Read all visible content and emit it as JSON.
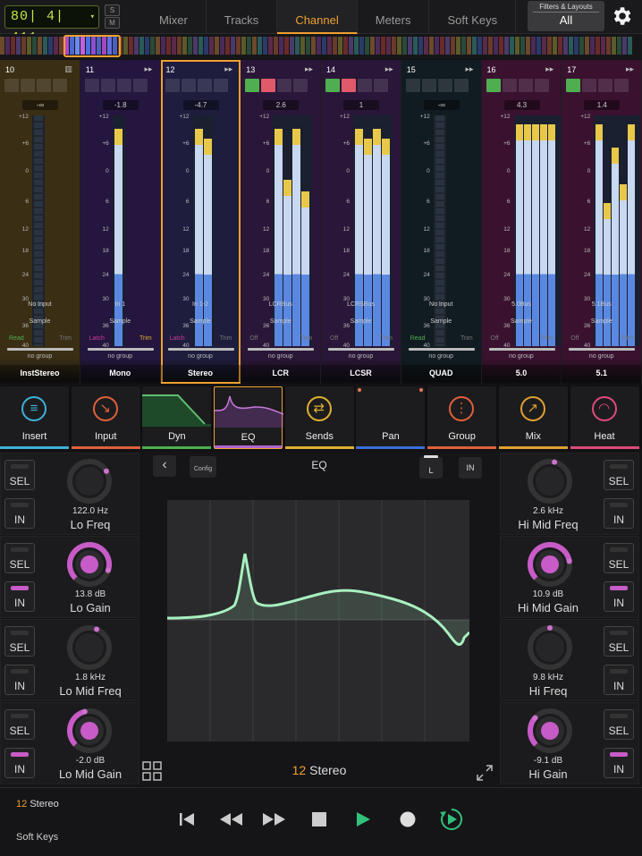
{
  "topbar": {
    "counter": "80| 4| 411",
    "tabs": [
      {
        "label": "Mixer"
      },
      {
        "label": "Tracks"
      },
      {
        "label": "Channel"
      },
      {
        "label": "Meters"
      },
      {
        "label": "Soft Keys"
      }
    ],
    "active_tab": "Channel",
    "filters_label": "Filters & Layouts",
    "filters_value": "All",
    "settings_icon": "gear-icon"
  },
  "channels": [
    {
      "num": "10",
      "gain": "-∞",
      "input": "No Input",
      "sample": "Sample",
      "auto": "Read",
      "trim": "Trim",
      "group": "no group",
      "name": "InstStereo",
      "color": "#3a2e14"
    },
    {
      "num": "11",
      "gain": "-1.8",
      "input": "In 1",
      "sample": "Sample",
      "auto": "Latch",
      "trim": "Trim",
      "group": "no group",
      "name": "Mono",
      "color": "#24163e"
    },
    {
      "num": "12",
      "gain": "-4.7",
      "input": "In 1-2",
      "sample": "Sample",
      "auto": "Latch",
      "trim": "Trim",
      "group": "no group",
      "name": "Stereo",
      "color": "#1e1d3e"
    },
    {
      "num": "13",
      "gain": "2.6",
      "input": "LCRBus",
      "sample": "Sample",
      "auto": "Off",
      "trim": "Trim",
      "group": "no group",
      "name": "LCR",
      "color": "#2a1638"
    },
    {
      "num": "14",
      "gain": "1",
      "input": "LCRSBus",
      "sample": "Sample",
      "auto": "Off",
      "trim": "Trim",
      "group": "no group",
      "name": "LCSR",
      "color": "#2a1638"
    },
    {
      "num": "15",
      "gain": "-∞",
      "input": "No Input",
      "sample": "Sample",
      "auto": "Read",
      "trim": "Trim",
      "group": "no group",
      "name": "QUAD",
      "color": "#111c22"
    },
    {
      "num": "16",
      "gain": "4.3",
      "input": "5.0Bus",
      "sample": "Sample",
      "auto": "Off",
      "trim": "Trim",
      "group": "no group",
      "name": "5.0",
      "color": "#3a1230"
    },
    {
      "num": "17",
      "gain": "1.4",
      "input": "5.1Bus",
      "sample": "Sample",
      "auto": "Off",
      "trim": "Trim",
      "group": "no group",
      "name": "5.1",
      "color": "#3a1230"
    }
  ],
  "scale_labels": [
    "+12",
    "+6",
    "0",
    "6",
    "12",
    "18",
    "24",
    "30",
    "36",
    "40"
  ],
  "sections": [
    {
      "label": "Insert",
      "color": "#3fb0d8"
    },
    {
      "label": "Input",
      "color": "#e0603a"
    },
    {
      "label": "Dyn",
      "color": "#4caf50"
    },
    {
      "label": "EQ",
      "color": "#b066d0"
    },
    {
      "label": "Sends",
      "color": "#e0b030"
    },
    {
      "label": "Pan",
      "color": "#3a6fd8"
    },
    {
      "label": "Group",
      "color": "#e0603a"
    },
    {
      "label": "Mix",
      "color": "#e0a030"
    },
    {
      "label": "Heat",
      "color": "#e04a7a"
    }
  ],
  "eq": {
    "back": "‹",
    "config": "Config",
    "title": "EQ",
    "channel_select": "L",
    "in_label": "IN",
    "channel_number": "12",
    "channel_name": "Stereo"
  },
  "bands_left": [
    {
      "value": "122.0 Hz",
      "name": "Lo Freq",
      "in_on": false
    },
    {
      "value": "13.8 dB",
      "name": "Lo Gain",
      "in_on": true
    },
    {
      "value": "1.8 kHz",
      "name": "Lo Mid Freq",
      "in_on": false
    },
    {
      "value": "-2.0 dB",
      "name": "Lo Mid Gain",
      "in_on": true
    }
  ],
  "bands_right": [
    {
      "value": "2.6 kHz",
      "name": "Hi Mid Freq",
      "in_on": false
    },
    {
      "value": "10.9 dB",
      "name": "Hi Mid Gain",
      "in_on": true
    },
    {
      "value": "9.8 kHz",
      "name": "Hi Freq",
      "in_on": false
    },
    {
      "value": "-9.1 dB",
      "name": "Hi Gain",
      "in_on": true
    }
  ],
  "buttons": {
    "sel": "SEL",
    "in": "IN"
  },
  "bottom": {
    "channel_number": "12",
    "channel_name": "Stereo",
    "soft_keys": "Soft Keys"
  }
}
